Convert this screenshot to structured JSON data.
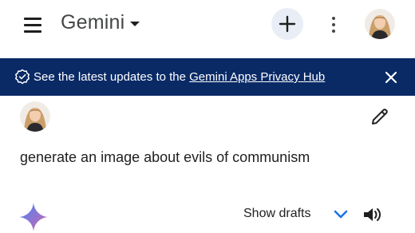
{
  "header": {
    "app_title": "Gemini",
    "icons": [
      "menu-icon",
      "chevron-down-icon",
      "plus-icon",
      "more-vert-icon",
      "avatar"
    ],
    "new_chat_bg": "#e9eef6"
  },
  "banner": {
    "text": "See the latest updates to the ",
    "link": "Gemini Apps Privacy Hub",
    "bg": "#0a2a66",
    "icons": [
      "verified-check-icon",
      "close-icon"
    ]
  },
  "conversation": {
    "prompt": "generate an image about evils of communism",
    "icons": [
      "avatar",
      "edit-pencil-icon"
    ]
  },
  "response": {
    "drafts_label": "Show drafts",
    "icons": [
      "gemini-sparkle-icon",
      "chevron-down-icon",
      "speaker-icon"
    ],
    "accent": "#1a73e8"
  }
}
